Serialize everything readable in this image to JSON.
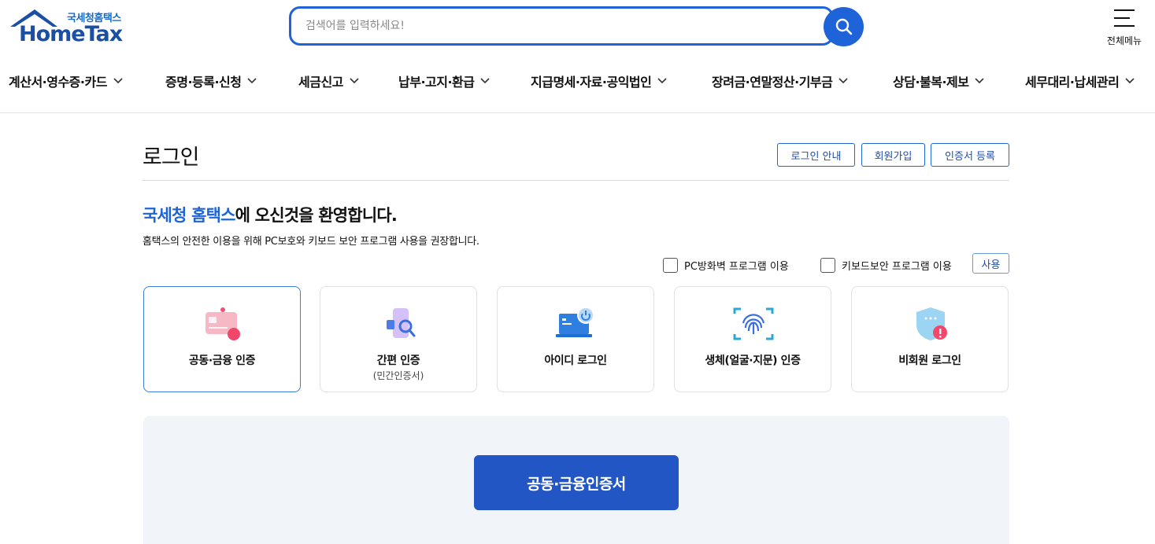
{
  "header": {
    "logo_sub": "국세청홈택스",
    "logo_main": "HomeTax",
    "search_placeholder": "검색어를 입력하세요!",
    "menu_label": "전체메뉴"
  },
  "gnb": [
    {
      "label": "계산서·영수증·카드"
    },
    {
      "label": "증명·등록·신청"
    },
    {
      "label": "세금신고"
    },
    {
      "label": "납부·고지·환급"
    },
    {
      "label": "지급명세·자료·공익법인"
    },
    {
      "label": "장려금·연말정산·기부금"
    },
    {
      "label": "상담·불복·제보"
    },
    {
      "label": "세무대리·납세관리"
    }
  ],
  "page": {
    "title": "로그인",
    "buttons": {
      "guide": "로그인 안내",
      "signup": "회원가입",
      "cert_register": "인증서 등록"
    },
    "welcome_accent": "국세청 홈택스",
    "welcome_rest": "에 오신것을 환영합니다.",
    "notice": "홈택스의 안전한 이용을 위해 PC보호와 키보드 보안 프로그램 사용을 권장합니다.",
    "options": {
      "firewall": "PC방화벽 프로그램 이용",
      "keyboard": "키보드보안 프로그램 이용",
      "use_button": "사용"
    }
  },
  "login_methods": [
    {
      "label": "공동·금융 인증",
      "sub": "",
      "icon": "card-icon",
      "selected": true
    },
    {
      "label": "간편 인증",
      "sub": "(민간인증서)",
      "icon": "phone-search-icon",
      "selected": false
    },
    {
      "label": "아이디 로그인",
      "sub": "",
      "icon": "laptop-power-icon",
      "selected": false
    },
    {
      "label": "생체(얼굴·지문) 인증",
      "sub": "",
      "icon": "fingerprint-icon",
      "selected": false
    },
    {
      "label": "비회원 로그인",
      "sub": "",
      "icon": "shield-icon",
      "selected": false
    }
  ],
  "panel": {
    "cert_button": "공동·금융인증서"
  },
  "colors": {
    "primary": "#1f63d8",
    "primary_dark": "#2256c5",
    "panel_bg": "#f1f4f9"
  }
}
